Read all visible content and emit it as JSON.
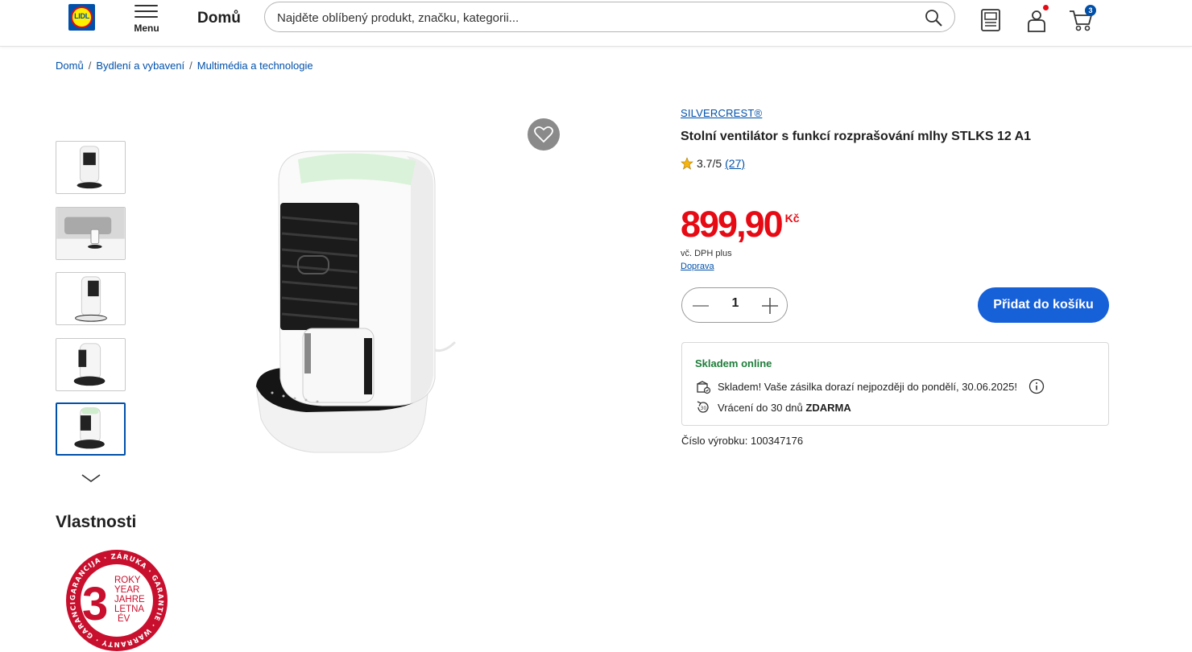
{
  "header": {
    "logo_text": "LIDL",
    "menu_label": "Menu",
    "home_label": "Domů",
    "search_placeholder": "Najděte oblíbený produkt, značku, kategorii...",
    "cart_count": "3"
  },
  "breadcrumb": {
    "items": [
      "Domů",
      "Bydlení a vybavení",
      "Multimédia a technologie"
    ],
    "separator": "/"
  },
  "product": {
    "brand": "SILVERCREST®",
    "title": "Stolní ventilátor s funkcí rozprašování mlhy STLKS 12 A1",
    "rating": "3.7/5",
    "review_count": "(27)",
    "price": "899,90",
    "currency": "Kč",
    "vat_note": "vč. DPH plus",
    "shipping_link": "Doprava",
    "quantity": "1",
    "add_to_cart_label": "Přidat do košíku",
    "product_number_label": "Číslo výrobku: 100347176"
  },
  "availability": {
    "status": "Skladem online",
    "delivery_text": "Skladem! Vaše zásilka dorazí nejpozději do pondělí, 30.06.2025!",
    "return_prefix": "Vrácení do 30 dnů",
    "return_bold": "ZDARMA"
  },
  "gallery": {
    "thumbnail_count": 5,
    "active_thumbnail": 5
  },
  "features": {
    "heading": "Vlastnosti",
    "warranty_number": "3",
    "warranty_lines": [
      "ROKY",
      "YEAR",
      "JAHRE",
      "LETNA",
      "ÉV"
    ],
    "warranty_ring_text": "GARANCIJA · ZÁRUKA · GARANTIE · WARRANTY · GARANCIA"
  },
  "colors": {
    "brand_blue": "#0050aa",
    "button_blue": "#1660d8",
    "price_red": "#e60a14",
    "stock_green": "#1e7d3a",
    "warranty_red": "#c8102e"
  }
}
